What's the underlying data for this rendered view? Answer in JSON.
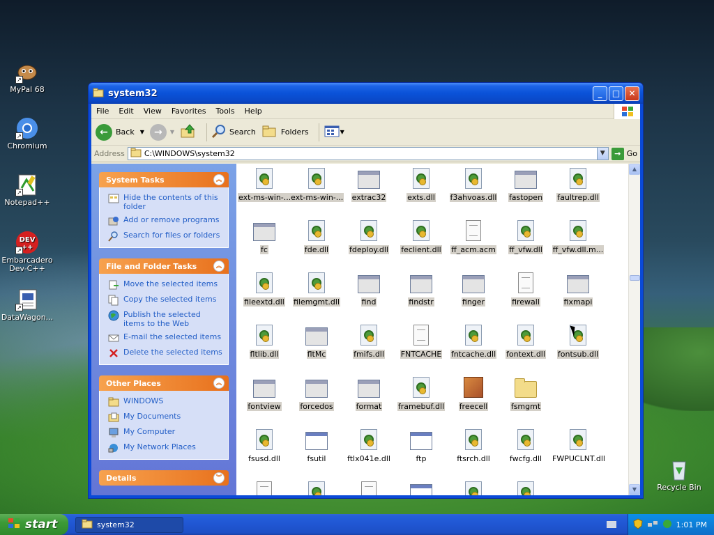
{
  "desktop": {
    "icons": [
      {
        "label": "MyPal 68",
        "icon": "mypal-icon"
      },
      {
        "label": "Chromium",
        "icon": "chromium-icon"
      },
      {
        "label": "Notepad++",
        "icon": "notepad-plus-plus-icon"
      },
      {
        "label": "Embarcadero Dev-C++",
        "icon": "devcpp-icon"
      },
      {
        "label": "DataWagon...",
        "icon": "datawagon-icon"
      },
      {
        "label": "Recycle Bin",
        "icon": "recycle-bin-icon"
      }
    ]
  },
  "window": {
    "title": "system32",
    "menu": [
      "File",
      "Edit",
      "View",
      "Favorites",
      "Tools",
      "Help"
    ],
    "toolbar": {
      "back": "Back",
      "search": "Search",
      "folders": "Folders"
    },
    "address": {
      "label": "Address",
      "value": "C:\\WINDOWS\\system32",
      "go": "Go"
    }
  },
  "taskpane": {
    "system_tasks": {
      "title": "System Tasks",
      "items": [
        "Hide the contents of this folder",
        "Add or remove programs",
        "Search for files or folders"
      ]
    },
    "file_folder_tasks": {
      "title": "File and Folder Tasks",
      "items": [
        "Move the selected items",
        "Copy the selected items",
        "Publish the selected items to the Web",
        "E-mail the selected items",
        "Delete the selected items"
      ]
    },
    "other_places": {
      "title": "Other Places",
      "items": [
        "WINDOWS",
        "My Documents",
        "My Computer",
        "My Network Places"
      ]
    },
    "details": {
      "title": "Details"
    }
  },
  "files": [
    {
      "name": "ext-ms-win-...",
      "type": "dll",
      "selected": true
    },
    {
      "name": "ext-ms-win-...",
      "type": "dll",
      "selected": true
    },
    {
      "name": "extrac32",
      "type": "exe",
      "selected": true
    },
    {
      "name": "exts.dll",
      "type": "dll",
      "selected": true
    },
    {
      "name": "f3ahvoas.dll",
      "type": "dll",
      "selected": true
    },
    {
      "name": "fastopen",
      "type": "exe",
      "selected": true
    },
    {
      "name": "faultrep.dll",
      "type": "dll",
      "selected": true
    },
    {
      "name": "fc",
      "type": "exe",
      "selected": true
    },
    {
      "name": "fde.dll",
      "type": "dll",
      "selected": true
    },
    {
      "name": "fdeploy.dll",
      "type": "dll",
      "selected": true
    },
    {
      "name": "feclient.dll",
      "type": "dll",
      "selected": true
    },
    {
      "name": "ff_acm.acm",
      "type": "txt",
      "selected": true
    },
    {
      "name": "ff_vfw.dll",
      "type": "dll",
      "selected": true
    },
    {
      "name": "ff_vfw.dll.m...",
      "type": "dll",
      "selected": true
    },
    {
      "name": "fileextd.dll",
      "type": "dll",
      "selected": true
    },
    {
      "name": "filemgmt.dll",
      "type": "dll",
      "selected": true
    },
    {
      "name": "find",
      "type": "exe",
      "selected": true
    },
    {
      "name": "findstr",
      "type": "exe",
      "selected": true
    },
    {
      "name": "finger",
      "type": "exe",
      "selected": true
    },
    {
      "name": "firewall",
      "type": "txt",
      "selected": true
    },
    {
      "name": "fixmapi",
      "type": "exe",
      "selected": true
    },
    {
      "name": "fltlib.dll",
      "type": "dll",
      "selected": true
    },
    {
      "name": "fltMc",
      "type": "exe",
      "selected": true
    },
    {
      "name": "fmifs.dll",
      "type": "dll",
      "selected": true
    },
    {
      "name": "FNTCACHE",
      "type": "txt",
      "selected": true
    },
    {
      "name": "fntcache.dll",
      "type": "dll",
      "selected": true
    },
    {
      "name": "fontext.dll",
      "type": "dll",
      "selected": true
    },
    {
      "name": "fontsub.dll",
      "type": "dll",
      "selected": true
    },
    {
      "name": "fontview",
      "type": "exe",
      "selected": true
    },
    {
      "name": "forcedos",
      "type": "exe",
      "selected": true
    },
    {
      "name": "format",
      "type": "exe",
      "selected": true
    },
    {
      "name": "framebuf.dll",
      "type": "dll",
      "selected": true
    },
    {
      "name": "freecell",
      "type": "freecell",
      "selected": true
    },
    {
      "name": "fsmgmt",
      "type": "folder",
      "selected": true
    },
    {
      "name": "",
      "type": "none",
      "selected": false
    },
    {
      "name": "fsusd.dll",
      "type": "dll",
      "selected": false
    },
    {
      "name": "fsutil",
      "type": "exe2",
      "selected": false
    },
    {
      "name": "ftlx041e.dll",
      "type": "dll",
      "selected": false
    },
    {
      "name": "ftp",
      "type": "exe2",
      "selected": false
    },
    {
      "name": "ftsrch.dll",
      "type": "dll",
      "selected": false
    },
    {
      "name": "fwcfg.dll",
      "type": "dll",
      "selected": false
    },
    {
      "name": "FWPUCLNT.dll",
      "type": "dll",
      "selected": false
    }
  ],
  "taskbar": {
    "start": "start",
    "task": "system32",
    "clock": "1:01 PM"
  }
}
